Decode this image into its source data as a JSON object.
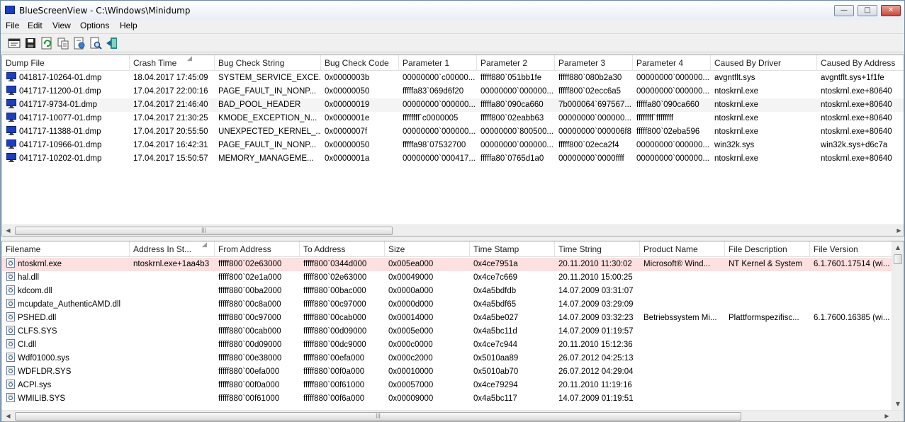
{
  "window": {
    "title": "BlueScreenView  -  C:\\Windows\\Minidump"
  },
  "menu": [
    "File",
    "Edit",
    "View",
    "Options",
    "Help"
  ],
  "toolbar": [
    "properties-icon",
    "save-icon",
    "refresh-icon",
    "copy-icon",
    "html-report-icon",
    "find-icon",
    "exit-icon"
  ],
  "dumps": {
    "columns": [
      "Dump File",
      "Crash Time",
      "Bug Check String",
      "Bug Check Code",
      "Parameter 1",
      "Parameter 2",
      "Parameter 3",
      "Parameter 4",
      "Caused By Driver",
      "Caused By Address"
    ],
    "rows": [
      [
        "041817-10264-01.dmp",
        "18.04.2017 17:45:09",
        "SYSTEM_SERVICE_EXCE...",
        "0x0000003b",
        "00000000`c00000...",
        "fffff880`051bb1fe",
        "fffff880`080b2a30",
        "00000000`000000...",
        "avgntflt.sys",
        "avgntflt.sys+1f1fe"
      ],
      [
        "041717-11200-01.dmp",
        "17.04.2017 22:00:16",
        "PAGE_FAULT_IN_NONP...",
        "0x00000050",
        "fffffa83`069d6f20",
        "00000000`000000...",
        "fffff800`02ecc6a5",
        "00000000`000000...",
        "ntoskrnl.exe",
        "ntoskrnl.exe+80640"
      ],
      [
        "041717-9734-01.dmp",
        "17.04.2017 21:46:40",
        "BAD_POOL_HEADER",
        "0x00000019",
        "00000000`000000...",
        "fffffa80`090ca660",
        "7b000064`697567...",
        "fffffa80`090ca660",
        "ntoskrnl.exe",
        "ntoskrnl.exe+80640"
      ],
      [
        "041717-10077-01.dmp",
        "17.04.2017 21:30:25",
        "KMODE_EXCEPTION_N...",
        "0x0000001e",
        "ffffffff`c0000005",
        "fffff800`02eabb63",
        "00000000`000000...",
        "ffffffff`ffffffff",
        "ntoskrnl.exe",
        "ntoskrnl.exe+80640"
      ],
      [
        "041717-11388-01.dmp",
        "17.04.2017 20:55:50",
        "UNEXPECTED_KERNEL_...",
        "0x0000007f",
        "00000000`000000...",
        "00000000`800500...",
        "00000000`000006f8",
        "fffff800`02eba596",
        "ntoskrnl.exe",
        "ntoskrnl.exe+80640"
      ],
      [
        "041717-10966-01.dmp",
        "17.04.2017 16:42:31",
        "PAGE_FAULT_IN_NONP...",
        "0x00000050",
        "fffffa98`07532700",
        "00000000`000000...",
        "fffff800`02eca2f4",
        "00000000`000000...",
        "win32k.sys",
        "win32k.sys+d6c7a"
      ],
      [
        "041717-10202-01.dmp",
        "17.04.2017 15:50:57",
        "MEMORY_MANAGEME...",
        "0x0000001a",
        "00000000`000417...",
        "fffffa80`0765d1a0",
        "00000000`0000ffff",
        "00000000`000000...",
        "ntoskrnl.exe",
        "ntoskrnl.exe+80640"
      ]
    ]
  },
  "drivers": {
    "columns": [
      "Filename",
      "Address In St...",
      "From Address",
      "To Address",
      "Size",
      "Time Stamp",
      "Time String",
      "Product Name",
      "File Description",
      "File Version"
    ],
    "rows": [
      [
        "ntoskrnl.exe",
        "ntoskrnl.exe+1aa4b3",
        "fffff800`02e63000",
        "fffff800`0344d000",
        "0x005ea000",
        "0x4ce7951a",
        "20.11.2010 11:30:02",
        "Microsoft® Wind...",
        "NT Kernel & System",
        "6.1.7601.17514 (wi..."
      ],
      [
        "hal.dll",
        "",
        "fffff800`02e1a000",
        "fffff800`02e63000",
        "0x00049000",
        "0x4ce7c669",
        "20.11.2010 15:00:25",
        "",
        "",
        ""
      ],
      [
        "kdcom.dll",
        "",
        "fffff880`00ba2000",
        "fffff880`00bac000",
        "0x0000a000",
        "0x4a5bdfdb",
        "14.07.2009 03:31:07",
        "",
        "",
        ""
      ],
      [
        "mcupdate_AuthenticAMD.dll",
        "",
        "fffff880`00c8a000",
        "fffff880`00c97000",
        "0x0000d000",
        "0x4a5bdf65",
        "14.07.2009 03:29:09",
        "",
        "",
        ""
      ],
      [
        "PSHED.dll",
        "",
        "fffff880`00c97000",
        "fffff880`00cab000",
        "0x00014000",
        "0x4a5be027",
        "14.07.2009 03:32:23",
        "Betriebssystem Mi...",
        "Plattformspezifisc...",
        "6.1.7600.16385 (wi..."
      ],
      [
        "CLFS.SYS",
        "",
        "fffff880`00cab000",
        "fffff880`00d09000",
        "0x0005e000",
        "0x4a5bc11d",
        "14.07.2009 01:19:57",
        "",
        "",
        ""
      ],
      [
        "CI.dll",
        "",
        "fffff880`00d09000",
        "fffff880`00dc9000",
        "0x000c0000",
        "0x4ce7c944",
        "20.11.2010 15:12:36",
        "",
        "",
        ""
      ],
      [
        "Wdf01000.sys",
        "",
        "fffff880`00e38000",
        "fffff880`00efa000",
        "0x000c2000",
        "0x5010aa89",
        "26.07.2012 04:25:13",
        "",
        "",
        ""
      ],
      [
        "WDFLDR.SYS",
        "",
        "fffff880`00efa000",
        "fffff880`00f0a000",
        "0x00010000",
        "0x5010ab70",
        "26.07.2012 04:29:04",
        "",
        "",
        ""
      ],
      [
        "ACPI.sys",
        "",
        "fffff880`00f0a000",
        "fffff880`00f61000",
        "0x00057000",
        "0x4ce79294",
        "20.11.2010 11:19:16",
        "",
        "",
        ""
      ],
      [
        "WMILIB.SYS",
        "",
        "fffff880`00f61000",
        "fffff880`00f6a000",
        "0x00009000",
        "0x4a5bc117",
        "14.07.2009 01:19:51",
        "",
        "",
        ""
      ]
    ]
  },
  "colors": {
    "selected_row": "#f4f4f4",
    "highlight_row": "#fde0e0",
    "dump_icon": "#1a3fbf"
  }
}
